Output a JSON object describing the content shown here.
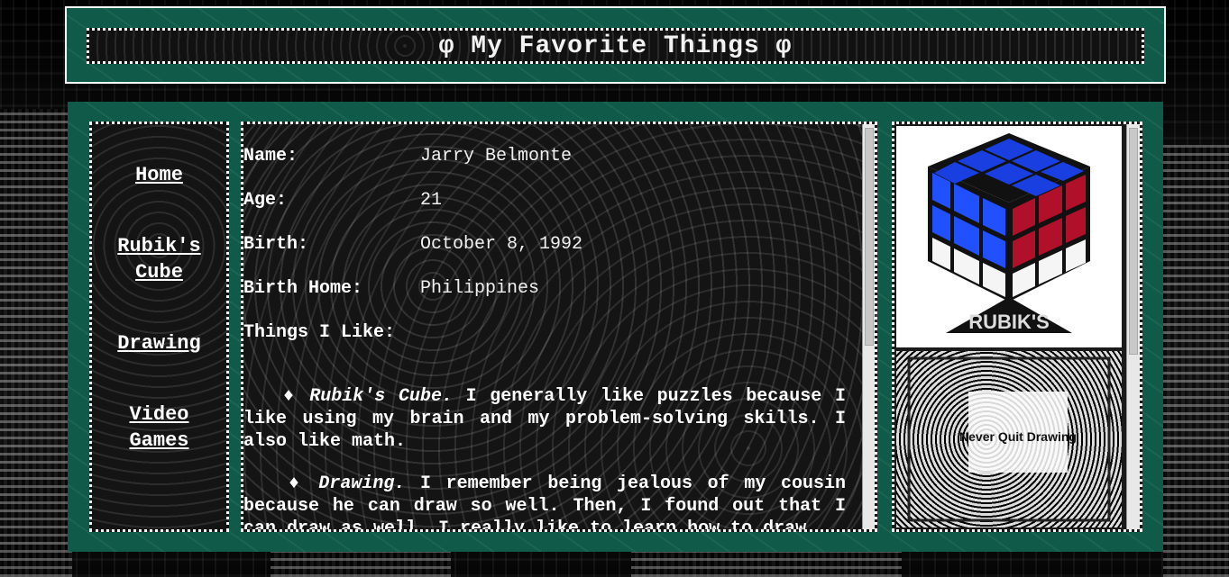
{
  "header": {
    "title": "φ My Favorite Things φ"
  },
  "nav": {
    "items": [
      {
        "label": "Home"
      },
      {
        "label": "Rubik's Cube"
      },
      {
        "label": "Drawing"
      },
      {
        "label": "Video Games"
      }
    ]
  },
  "profile": {
    "name_label": "Name:",
    "name_value": "Jarry Belmonte",
    "age_label": "Age:",
    "age_value": "21",
    "birth_label": "Birth:",
    "birth_value": "October 8, 1992",
    "home_label": "Birth Home:",
    "home_value": "Philippines",
    "likes_label": "Things I Like:"
  },
  "likes": [
    {
      "bullet": "♦",
      "title": "Rubik's Cube.",
      "text": " I generally like puzzles because I like using my brain and my problem-solving skills. I also like math."
    },
    {
      "bullet": "♦",
      "title": "Drawing.",
      "text": " I remember being jealous of my cousin because he can draw so well. Then, I found out that I can draw as well. I really like to learn how to draw..."
    }
  ],
  "images": {
    "cube_logo": "RUBIK'S",
    "doodle_text": "Never Quit Drawing"
  },
  "colors": {
    "panel_green": "#0f5a48",
    "dark_panel": "#141414",
    "text": "#ffffff"
  }
}
